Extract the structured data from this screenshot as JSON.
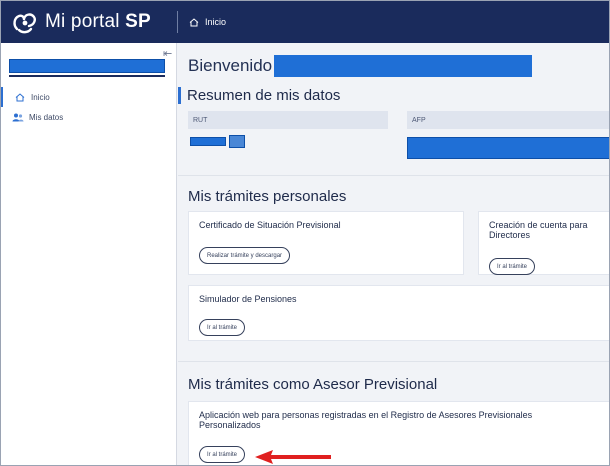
{
  "app": {
    "name_regular": "Mi portal ",
    "name_bold": "SP"
  },
  "breadcrumb": {
    "label": "Inicio"
  },
  "sidebar": {
    "collapse_glyph": "⇤",
    "items": [
      {
        "label": "Inicio",
        "icon": "home-icon"
      },
      {
        "label": "Mis datos",
        "icon": "users-icon"
      }
    ]
  },
  "welcome": {
    "label": "Bienvenido"
  },
  "summary": {
    "title": "Resumen de mis datos",
    "fields": [
      {
        "label": "RUT"
      },
      {
        "label": "AFP"
      }
    ]
  },
  "personal": {
    "title": "Mis trámites personales",
    "cards": [
      {
        "title": "Certificado de Situación Previsional",
        "button": "Realizar trámite y descargar"
      },
      {
        "title": "Creación de cuenta para Directores",
        "button": "Ir al trámite"
      },
      {
        "title": "Simulador de Pensiones",
        "button": "Ir al trámite"
      }
    ]
  },
  "advisor": {
    "title": "Mis trámites como Asesor Previsional",
    "cards": [
      {
        "title": "Aplicación web para personas registradas en el Registro de Asesores Previsionales Personalizados",
        "button": "Ir al trámite"
      }
    ]
  },
  "colors": {
    "topbar": "#1a2b5c",
    "accent": "#2c6fd1",
    "redaction": "#1f6fd6",
    "arrow": "#e02020"
  }
}
